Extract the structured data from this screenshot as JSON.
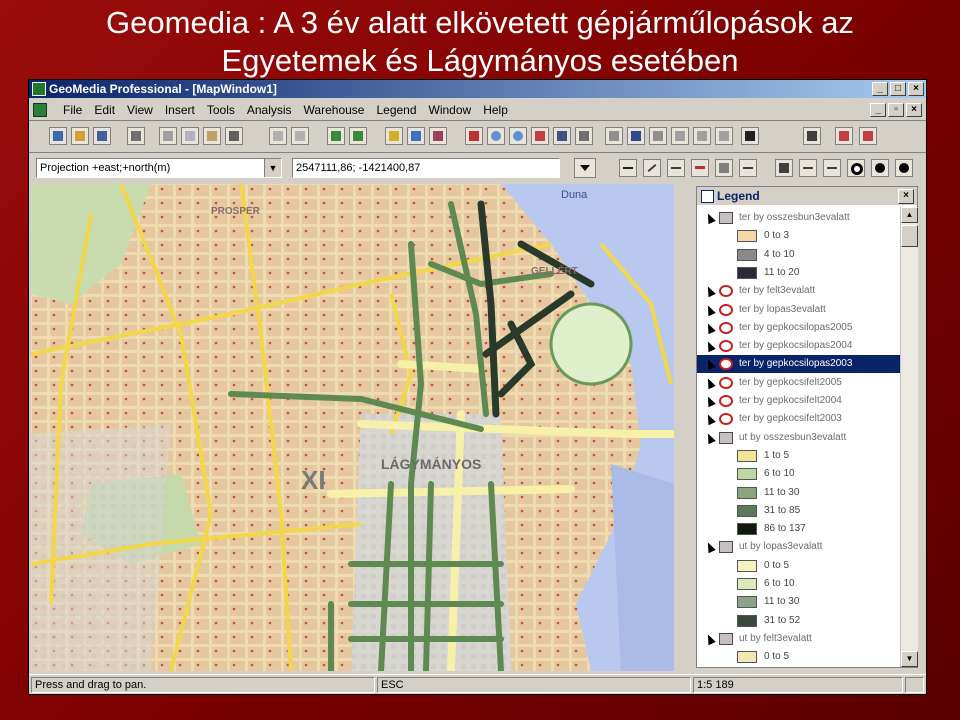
{
  "slide": {
    "title_line1": "Geomedia : A 3 év alatt elkövetett gépjárműlopások az",
    "title_line2": "Egyetemek és Lágymányos esetében"
  },
  "window": {
    "title": "GeoMedia Professional - [MapWindow1]",
    "controls": [
      "_",
      "□",
      "×"
    ],
    "mdi_controls": [
      "_",
      "▫",
      "×"
    ]
  },
  "menubar": {
    "items": [
      "File",
      "Edit",
      "View",
      "Insert",
      "Tools",
      "Analysis",
      "Warehouse",
      "Legend",
      "Window",
      "Help"
    ]
  },
  "toolbar2": {
    "projection": "Projection +east;+north(m)",
    "coordinates": "2547111,86; -1421400,87"
  },
  "map": {
    "labels": [
      "Duna",
      "XI",
      "LÁGYMÁNYOS",
      "GELLÉRT",
      "PROSPER"
    ]
  },
  "legend": {
    "title": "Legend",
    "close": "×",
    "rows": [
      {
        "kind": "layer",
        "text": "ter by osszesbun3evalatt",
        "icon": "polygon-icon"
      },
      {
        "kind": "class",
        "text": "0 to 3",
        "color": "#f4d8a8"
      },
      {
        "kind": "class",
        "text": "4 to 10",
        "color": "#8a8a8a"
      },
      {
        "kind": "class",
        "text": "11 to 20",
        "color": "#2a2a3a"
      },
      {
        "kind": "layer",
        "text": "ter by felt3evalatt",
        "icon": "circle-icon"
      },
      {
        "kind": "layer",
        "text": "ter by lopas3evalatt",
        "icon": "circle-icon"
      },
      {
        "kind": "layer",
        "text": "ter by gepkocsilopas2005",
        "icon": "circle-icon"
      },
      {
        "kind": "layer",
        "text": "ter by gepkocsilopas2004",
        "icon": "circle-icon"
      },
      {
        "kind": "layer",
        "text": "ter by gepkocsilopas2003",
        "icon": "circle-icon",
        "selected": true
      },
      {
        "kind": "layer",
        "text": "ter by gepkocsifelt2005",
        "icon": "circle-icon"
      },
      {
        "kind": "layer",
        "text": "ter by gepkocsifelt2004",
        "icon": "circle-icon"
      },
      {
        "kind": "layer",
        "text": "ter by gepkocsifelt2003",
        "icon": "circle-icon"
      },
      {
        "kind": "layer",
        "text": "ut by osszesbun3evalatt",
        "icon": "polygon-icon"
      },
      {
        "kind": "class",
        "text": "1 to 5",
        "color": "#f4e49a"
      },
      {
        "kind": "class",
        "text": "6 to 10",
        "color": "#bcd8a4"
      },
      {
        "kind": "class",
        "text": "11 to 30",
        "color": "#8aa47e"
      },
      {
        "kind": "class",
        "text": "31 to 85",
        "color": "#5a7a58"
      },
      {
        "kind": "class",
        "text": "86 to 137",
        "color": "#101810"
      },
      {
        "kind": "layer",
        "text": "ut by lopas3evalatt",
        "icon": "polygon-icon"
      },
      {
        "kind": "class",
        "text": "0 to 5",
        "color": "#f8f2c0"
      },
      {
        "kind": "class",
        "text": "6 to 10",
        "color": "#dceab8"
      },
      {
        "kind": "class",
        "text": "11 to 30",
        "color": "#8aa48a"
      },
      {
        "kind": "class",
        "text": "31 to 52",
        "color": "#3a4a3a"
      },
      {
        "kind": "layer",
        "text": "ut by felt3evalatt",
        "icon": "polygon-icon"
      },
      {
        "kind": "class",
        "text": "0 to 5",
        "color": "#f4e6b0"
      }
    ]
  },
  "status": {
    "message": "Press and drag to pan.",
    "key": "ESC",
    "scale": "1:5 189"
  }
}
